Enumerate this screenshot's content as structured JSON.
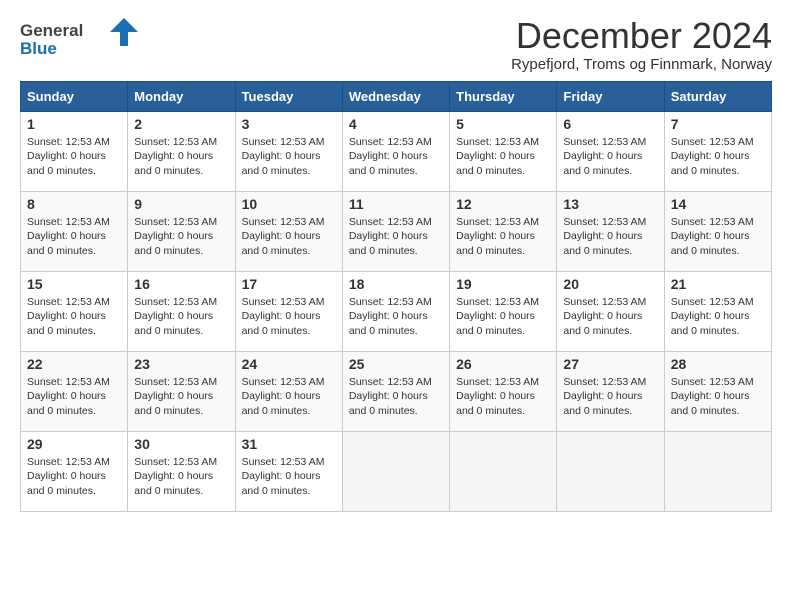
{
  "logo": {
    "text_general": "General",
    "text_blue": "Blue"
  },
  "header": {
    "month_year": "December 2024",
    "location": "Rypefjord, Troms og Finnmark, Norway"
  },
  "weekdays": [
    "Sunday",
    "Monday",
    "Tuesday",
    "Wednesday",
    "Thursday",
    "Friday",
    "Saturday"
  ],
  "day_info_template": {
    "sunset": "Sunset: 12:53 AM",
    "daylight": "Daylight: 0 hours and 0 minutes."
  },
  "weeks": [
    [
      {
        "date": "1",
        "has_data": true
      },
      {
        "date": "2",
        "has_data": true
      },
      {
        "date": "3",
        "has_data": true
      },
      {
        "date": "4",
        "has_data": true
      },
      {
        "date": "5",
        "has_data": true
      },
      {
        "date": "6",
        "has_data": true
      },
      {
        "date": "7",
        "has_data": true
      }
    ],
    [
      {
        "date": "8",
        "has_data": true
      },
      {
        "date": "9",
        "has_data": true
      },
      {
        "date": "10",
        "has_data": true
      },
      {
        "date": "11",
        "has_data": true
      },
      {
        "date": "12",
        "has_data": true
      },
      {
        "date": "13",
        "has_data": true
      },
      {
        "date": "14",
        "has_data": true
      }
    ],
    [
      {
        "date": "15",
        "has_data": true
      },
      {
        "date": "16",
        "has_data": true
      },
      {
        "date": "17",
        "has_data": true
      },
      {
        "date": "18",
        "has_data": true
      },
      {
        "date": "19",
        "has_data": true
      },
      {
        "date": "20",
        "has_data": true
      },
      {
        "date": "21",
        "has_data": true
      }
    ],
    [
      {
        "date": "22",
        "has_data": true
      },
      {
        "date": "23",
        "has_data": true
      },
      {
        "date": "24",
        "has_data": true
      },
      {
        "date": "25",
        "has_data": true
      },
      {
        "date": "26",
        "has_data": true
      },
      {
        "date": "27",
        "has_data": true
      },
      {
        "date": "28",
        "has_data": true
      }
    ],
    [
      {
        "date": "29",
        "has_data": true
      },
      {
        "date": "30",
        "has_data": true
      },
      {
        "date": "31",
        "has_data": true
      },
      {
        "date": "",
        "has_data": false
      },
      {
        "date": "",
        "has_data": false
      },
      {
        "date": "",
        "has_data": false
      },
      {
        "date": "",
        "has_data": false
      }
    ]
  ]
}
